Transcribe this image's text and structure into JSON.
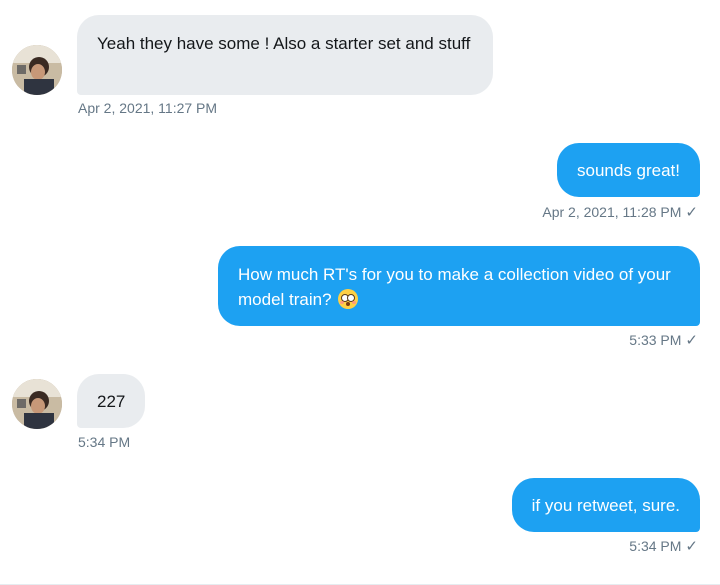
{
  "conversation": {
    "messages": [
      {
        "direction": "in",
        "text": "Yeah they have some ! Also a starter set and stuff",
        "timestamp": "Apr 2, 2021, 11:27 PM",
        "avatar_icon": "user-avatar"
      },
      {
        "direction": "out",
        "text": "sounds great!",
        "timestamp": "Apr 2, 2021, 11:28 PM",
        "status_icon": "check-icon"
      },
      {
        "direction": "out",
        "text": "How much RT's for you to make a collection video of your model train?",
        "emoji": "flushed-face",
        "timestamp": "5:33 PM",
        "status_icon": "check-icon"
      },
      {
        "direction": "in",
        "text": "227",
        "timestamp": "5:34 PM",
        "avatar_icon": "user-avatar"
      },
      {
        "direction": "out",
        "text": "if you retweet, sure.",
        "timestamp": "5:34 PM",
        "status_icon": "check-icon"
      }
    ],
    "check_glyph": "✓"
  },
  "colors": {
    "outgoing_bubble": "#1da1f2",
    "incoming_bubble": "#e9ecef",
    "timestamp": "#657786"
  }
}
